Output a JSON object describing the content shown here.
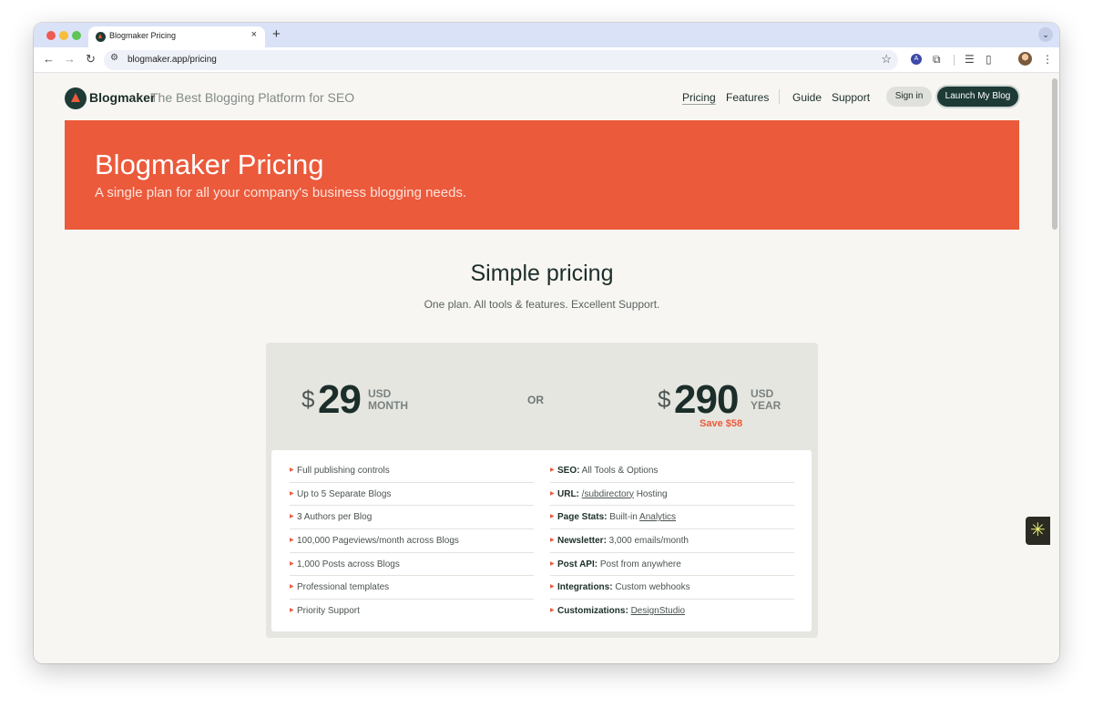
{
  "browser": {
    "tab_title": "Blogmaker Pricing",
    "tab_close": "×",
    "new_tab": "+",
    "tab_menu": "⌄",
    "back": "←",
    "forward": "→",
    "reload": "↻",
    "url": "blogmaker.app/pricing",
    "ext_badge": "A"
  },
  "header": {
    "brand": "Blogmaker",
    "tagline": "The Best Blogging Platform for SEO",
    "nav": [
      "Pricing",
      "Features",
      "Guide",
      "Support"
    ],
    "signin": "Sign in",
    "launch": "Launch My Blog"
  },
  "hero": {
    "title": "Blogmaker Pricing",
    "subtitle": "A single plan for all your company's business blogging needs."
  },
  "pricing": {
    "title": "Simple pricing",
    "subtitle": "One plan. All tools & features. Excellent Support.",
    "currency_symbol": "$",
    "monthly": {
      "amount": "29",
      "currency": "USD",
      "period": "MONTH"
    },
    "or": "OR",
    "yearly": {
      "amount": "290",
      "currency": "USD",
      "period": "YEAR",
      "savings": "Save $58"
    }
  },
  "features": {
    "left": [
      "Full publishing controls",
      "Up to 5 Separate Blogs",
      "3 Authors per Blog",
      "100,000 Pageviews/month across Blogs",
      "1,000 Posts across Blogs",
      "Professional templates",
      "Priority Support"
    ],
    "right": [
      {
        "key": "SEO:",
        "text": " All Tools & Options"
      },
      {
        "key": "URL:",
        "link": "/subdirectory",
        "text": " Hosting"
      },
      {
        "key": "Page Stats:",
        "text": " Built-in ",
        "link": "Analytics"
      },
      {
        "key": "Newsletter:",
        "text": " 3,000 emails/month"
      },
      {
        "key": "Post API:",
        "text": " Post from anywhere"
      },
      {
        "key": "Integrations:",
        "text": " Custom webhooks"
      },
      {
        "key": "Customizations:",
        "text": " ",
        "link": "DesignStudio"
      }
    ]
  },
  "colors": {
    "accent": "#eb5a3b",
    "brand_dark": "#1d3a35",
    "page_bg": "#f7f6f2"
  }
}
